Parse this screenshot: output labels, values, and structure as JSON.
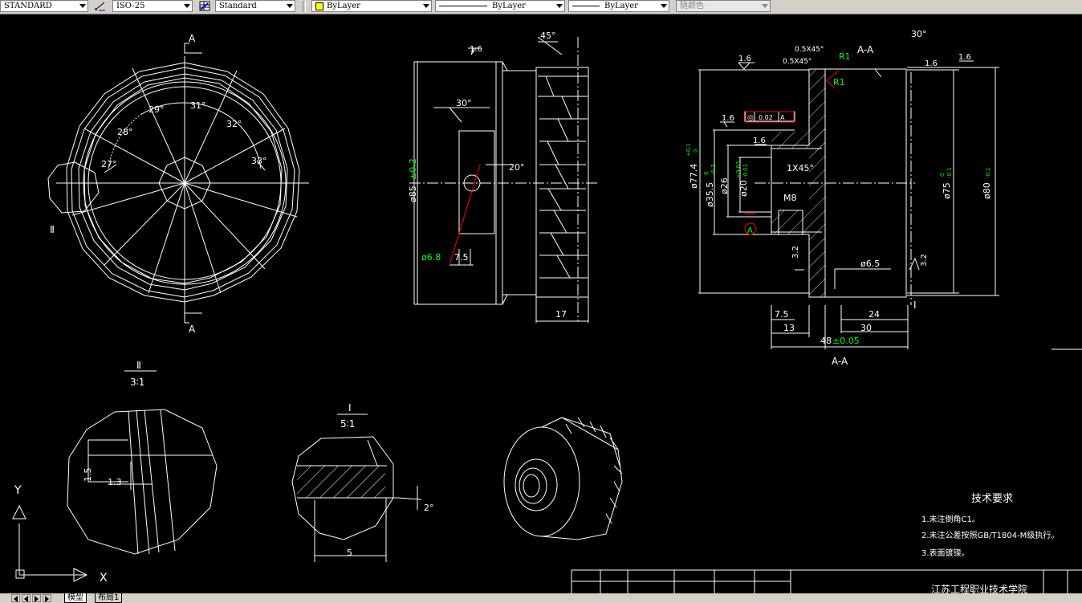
{
  "toolbar": {
    "text_style": "STANDARD",
    "dim_style": "ISO-25",
    "table_style": "Standard",
    "layer": "ByLayer",
    "linetype": "ByLayer",
    "lineweight": "ByLayer",
    "plot_style": "随颜色",
    "layer_color": "#ffff00"
  },
  "drawing": {
    "section_label_a": "A",
    "view_labels": {
      "aa": "A-A",
      "ii": "Ⅱ",
      "ii_scale": "3∶1",
      "i": "Ⅰ",
      "i_scale": "5∶1"
    },
    "front": {
      "angles": [
        "29°",
        "31°",
        "28°",
        "32°",
        "27°",
        "33°"
      ],
      "marker": "Ⅱ"
    },
    "side": {
      "roughness": "1.6",
      "angle45": "45°",
      "angle30": "30°",
      "angle20": "20°",
      "dia85": "ø85",
      "dia85_tol": "±0.2",
      "dia68": "ø6.8",
      "dim75": "7.5",
      "dim17": "17"
    },
    "section": {
      "chamfer1": "0.5X45°",
      "chamfer2": "0.5X45°",
      "r1a": "R1",
      "r1b": "R1",
      "angle30": "30°",
      "roughness": "1.6",
      "tol_sym": "◎",
      "tol_val": "0.02",
      "tol_ref": "A",
      "dia774": "ø77.4",
      "dia774_tol_up": "+0.1",
      "dia774_tol_lo": "0",
      "dia355": "ø35.5",
      "dia355_tol_up": "0",
      "dia355_tol_lo": "-0.3",
      "dia26": "ø26",
      "dia20": "ø20",
      "dia20_tol_up": "+0.03",
      "dia20_tol_lo": "-0.01",
      "chamfer1x45": "1X45°",
      "m8": "M8",
      "datum": "A",
      "dia75": "ø75",
      "dia75_tol_up": "0",
      "dia75_tol_lo": "-0.1",
      "dia80": "ø80",
      "dia80_tol_lo": "-0.1",
      "rough32a": "3.2",
      "rough32b": "3.2",
      "dia65": "ø6.5",
      "marker_i": "Ⅰ",
      "dim75": "7.5",
      "dim13": "13",
      "dim24": "24",
      "dim30": "30",
      "dim48": "48",
      "dim48_tol": "±0.05"
    },
    "detail2": {
      "dim15": "1.5",
      "dim13": "1.3"
    },
    "detail1": {
      "angle2": "2°",
      "dim5": "5"
    },
    "ucs": {
      "y": "Y",
      "x": "X"
    },
    "tech_req": {
      "title": "技术要求",
      "items": [
        "1.未注倒角C1。",
        "2.未注公差按照GB/T1804-M级执行。",
        "3.表面镀镍。"
      ]
    },
    "title_block": {
      "school": "江苏工程职业技术学院"
    }
  },
  "tabs": [
    "模型",
    "布局1"
  ],
  "colors": {
    "green": "#00ff00",
    "red": "#ff0000",
    "white": "#ffffff"
  }
}
